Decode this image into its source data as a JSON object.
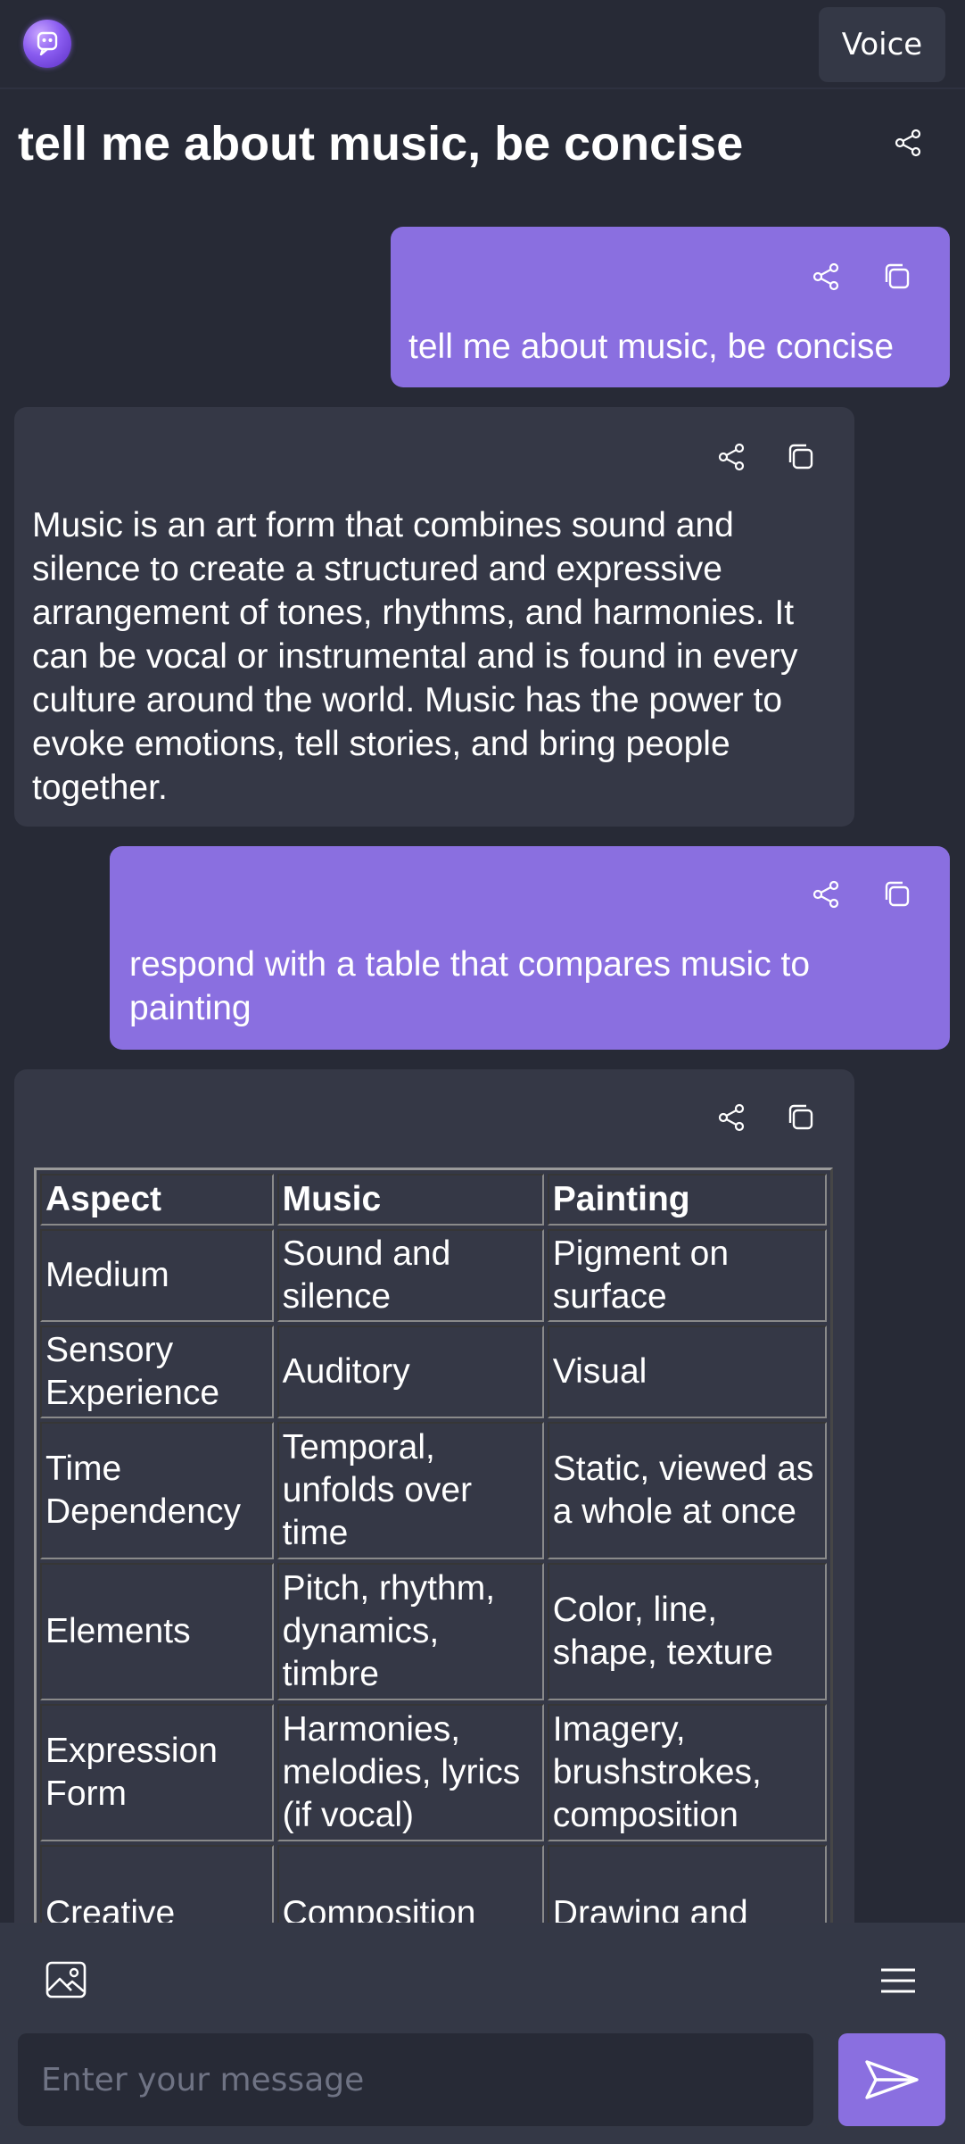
{
  "header": {
    "voice_label": "Voice",
    "logo_icon": "chat-bot-logo-icon"
  },
  "conversation": {
    "title": "tell me about music, be concise",
    "messages": [
      {
        "role": "user",
        "text": "tell me about music, be concise"
      },
      {
        "role": "assistant",
        "text": "Music is an art form that combines sound and silence to create a structured and expressive arrangement of tones, rhythms, and harmonies. It can be vocal or instrumental and is found in every culture around the world. Music has the power to evoke emotions, tell stories, and bring people together."
      },
      {
        "role": "user",
        "text": "respond with a table that compares music to painting"
      },
      {
        "role": "assistant",
        "table": {
          "headers": [
            "Aspect",
            "Music",
            "Painting"
          ],
          "rows": [
            [
              "Medium",
              "Sound and silence",
              "Pigment on surface"
            ],
            [
              "Sensory Experience",
              "Auditory",
              "Visual"
            ],
            [
              "Time Dependency",
              "Temporal, unfolds over time",
              "Static, viewed as a whole at once"
            ],
            [
              "Elements",
              "Pitch, rhythm, dynamics, timbre",
              "Color, line, shape, texture"
            ],
            [
              "Expression Form",
              "Harmonies, melodies, lyrics (if vocal)",
              "Imagery, brushstrokes, composition"
            ],
            [
              "Creative",
              "Composition",
              "Drawing and"
            ]
          ]
        }
      }
    ]
  },
  "composer": {
    "placeholder": "Enter your message",
    "image_icon": "image-icon",
    "menu_icon": "menu-icon",
    "send_icon": "send-icon"
  },
  "colors": {
    "background": "#272a36",
    "user_bubble": "#8a6fe0",
    "assistant_bubble": "#353846",
    "accent": "#8a6fe0"
  }
}
